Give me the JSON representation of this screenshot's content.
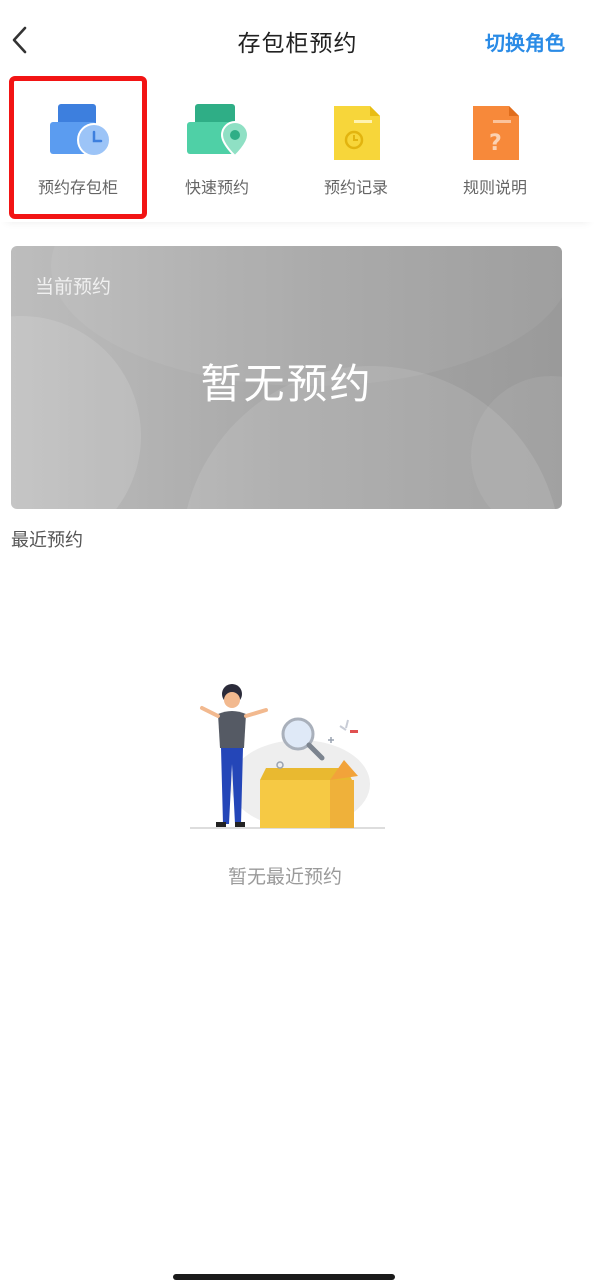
{
  "header": {
    "title": "存包柜预约",
    "switch_role": "切换角色"
  },
  "nav": [
    {
      "label": "预约存包柜",
      "icon": "locker-clock-icon",
      "color": "#4a8fe8"
    },
    {
      "label": "快速预约",
      "icon": "locker-location-icon",
      "color": "#3ec39a"
    },
    {
      "label": "预约记录",
      "icon": "record-document-icon",
      "color": "#f5d02a"
    },
    {
      "label": "规则说明",
      "icon": "rules-document-icon",
      "color": "#f7893a"
    }
  ],
  "current": {
    "label": "当前预约",
    "empty": "暂无预约"
  },
  "recent": {
    "title": "最近预约",
    "empty": "暂无最近预约"
  },
  "colors": {
    "accent": "#2a8be6",
    "highlight": "#f21414"
  }
}
